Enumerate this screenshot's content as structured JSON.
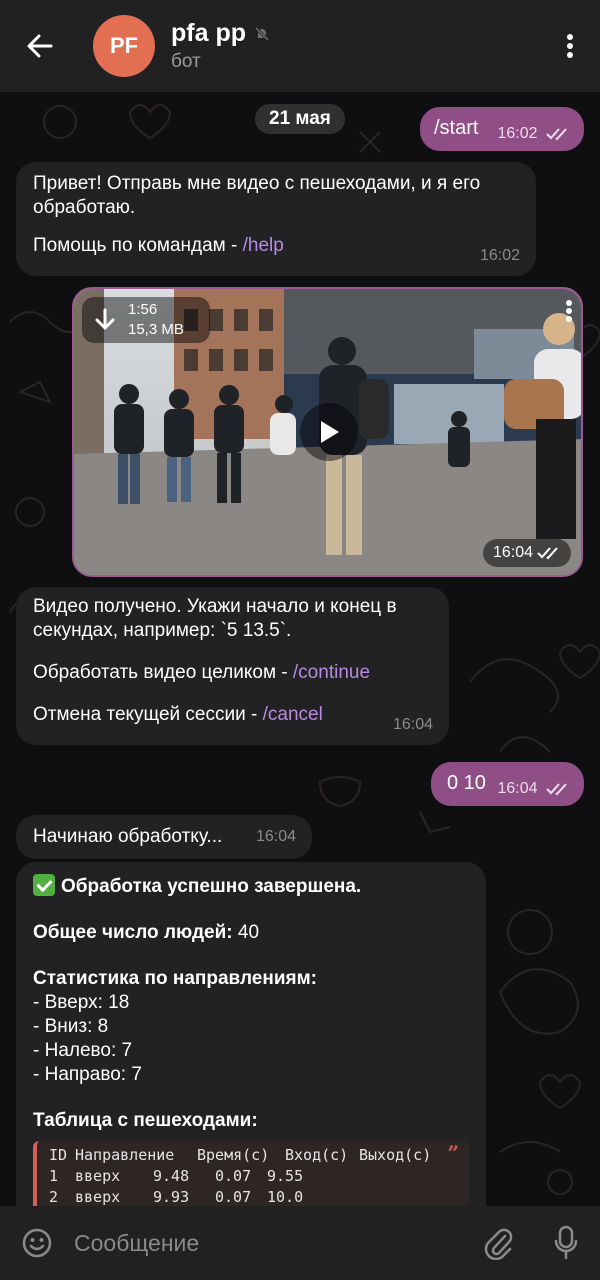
{
  "header": {
    "back_label": "Back",
    "avatar_initials": "PF",
    "title": "pfa pp",
    "subtitle": "бот",
    "muted_icon": "muted-bell-icon"
  },
  "chat": {
    "date": "21 мая",
    "messages": {
      "start": {
        "text": "/start",
        "time": "16:02"
      },
      "hello": {
        "line1": "Привет! Отправь мне видео с пешеходами, и я его обработаю.",
        "line2_prefix": "Помощь по командам - ",
        "line2_link": "/help",
        "time": "16:02"
      },
      "video": {
        "duration": "1:56",
        "size": "15,3 MB",
        "time": "16:04"
      },
      "video_ok": {
        "line1": "Видео получено. Укажи начало и конец в секундах, например: `5 13.5`.",
        "line2_prefix": "Обработать видео целиком - ",
        "line2_link": "/continue",
        "line3_prefix": "Отмена текущей сессии - ",
        "line3_link": "/cancel",
        "time": "16:04"
      },
      "range": {
        "text": "0 10",
        "time": "16:04"
      },
      "processing": {
        "text": "Начинаю обработку...",
        "time": "16:04"
      },
      "result": {
        "done": "Обработка успешно завершена.",
        "total_label": "Общее число людей:",
        "total_value": "40",
        "stats_title": "Статистика по направлениям:",
        "stats": [
          "- Вверх: 18",
          "- Вниз: 8",
          "- Налево: 7",
          "- Направо: 7"
        ],
        "table_title": "Таблица с пешеходами:",
        "table_header": [
          "ID",
          "Направление",
          "Время(с)",
          "Вход(с)",
          "Выход(с)"
        ],
        "table_rows": [
          [
            "1",
            "вверх",
            "9.48",
            "0.07",
            "9.55"
          ],
          [
            "2",
            "вверх",
            "9.93",
            "0.07",
            "10.0"
          ]
        ]
      }
    }
  },
  "input": {
    "placeholder": "Сообщение"
  },
  "colors": {
    "header_bg": "#212121",
    "incoming_bubble": "#222225",
    "outgoing_bubble": "#8f4e86",
    "link": "#b78be0",
    "avatar": "#e26f52",
    "quote_accent": "#d55e57"
  }
}
